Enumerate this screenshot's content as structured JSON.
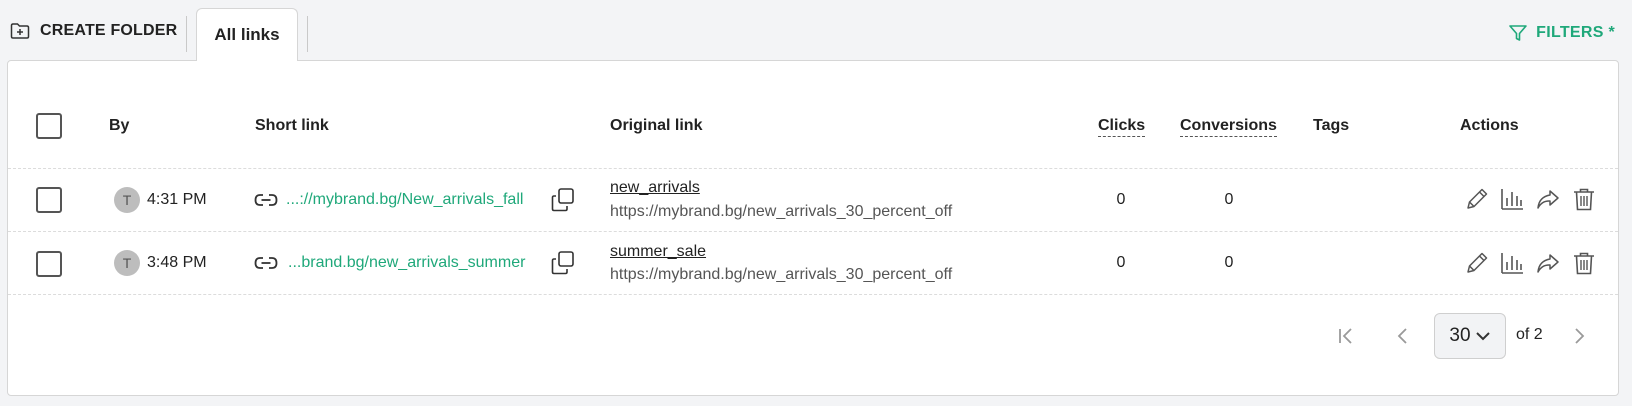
{
  "toolbar": {
    "create_folder_label": "CREATE FOLDER",
    "active_tab_label": "All links",
    "filters_label": "FILTERS *",
    "accent_color": "#1fa87a"
  },
  "table": {
    "columns": {
      "by": "By",
      "short_link": "Short link",
      "original_link": "Original link",
      "clicks": "Clicks",
      "conversions": "Conversions",
      "tags": "Tags",
      "actions": "Actions"
    },
    "rows": [
      {
        "avatar_initial": "T",
        "time": "4:31 PM",
        "short_link": "...://mybrand.bg/New_arrivals_fall",
        "original_title": "new_arrivals",
        "original_url": "https://mybrand.bg/new_arrivals_30_percent_off",
        "clicks": "0",
        "conversions": "0"
      },
      {
        "avatar_initial": "T",
        "time": "3:48 PM",
        "short_link": "...brand.bg/new_arrivals_summer",
        "original_title": "summer_sale",
        "original_url": "https://mybrand.bg/new_arrivals_30_percent_off",
        "clicks": "0",
        "conversions": "0"
      }
    ],
    "action_icons": [
      "edit-icon",
      "stats-icon",
      "share-icon",
      "trash-icon"
    ]
  },
  "pagination": {
    "page_size": "30",
    "of_pages": "of 2"
  }
}
